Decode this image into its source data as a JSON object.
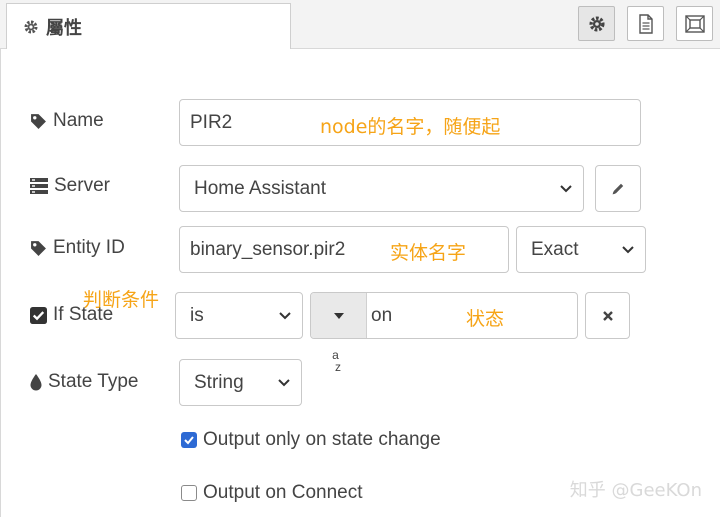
{
  "tab": {
    "title": "屬性"
  },
  "toolbar": {
    "icons": [
      "gear-icon",
      "document-icon",
      "frame-icon"
    ]
  },
  "form": {
    "name": {
      "label": "Name",
      "value": "PIR2",
      "annotation": "node的名字，随便起"
    },
    "server": {
      "label": "Server",
      "value": "Home Assistant"
    },
    "entity": {
      "label": "Entity ID",
      "value": "binary_sensor.pir2",
      "annotation": "实体名字",
      "match": "Exact"
    },
    "if_state": {
      "label": "If State",
      "annotation": "判断条件",
      "operator": "is",
      "value": "on",
      "value_annotation": "状态",
      "type_marker_top": "a",
      "type_marker_bottom": "z"
    },
    "state_type": {
      "label": "State Type",
      "value": "String"
    },
    "output_change": {
      "label": "Output only on state change",
      "checked": true
    },
    "output_connect": {
      "label": "Output on Connect",
      "checked": false
    }
  },
  "watermark": "知乎 @GeeKOn",
  "colors": {
    "annotation": "#f6a417",
    "checkbox": "#2d6ad4"
  }
}
